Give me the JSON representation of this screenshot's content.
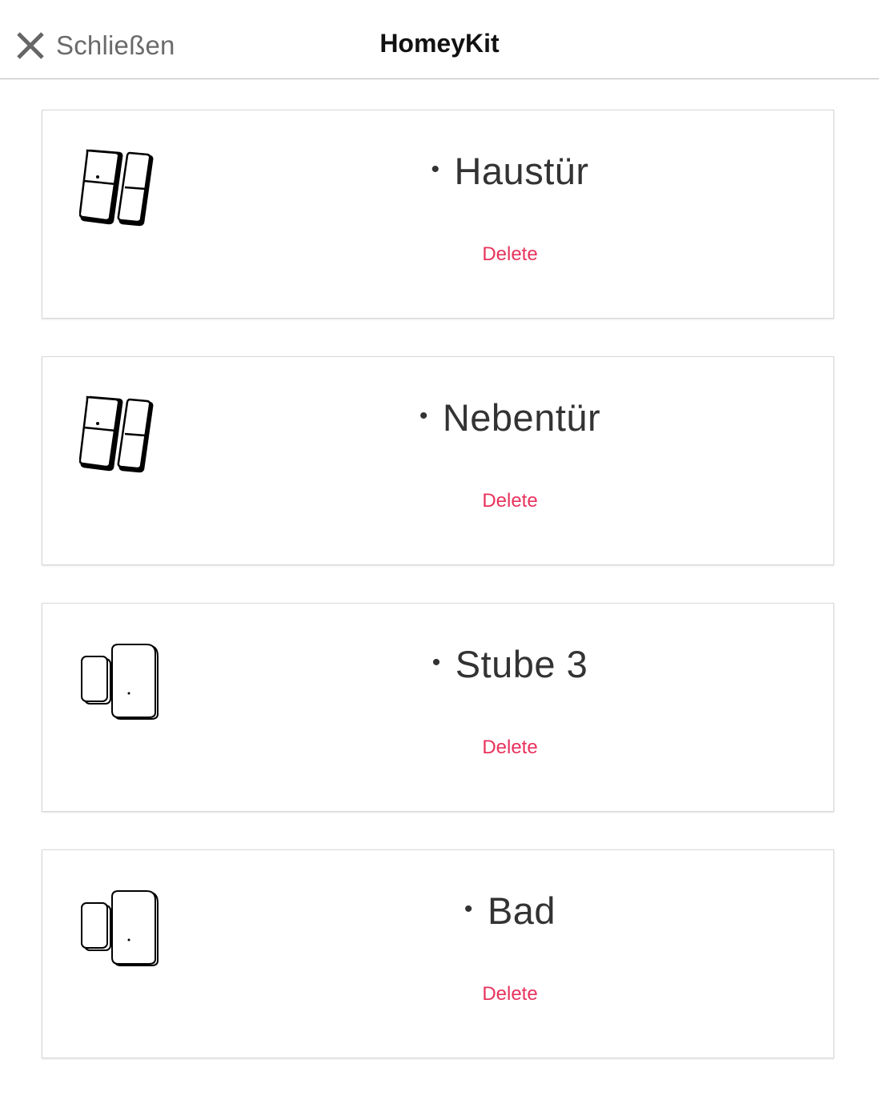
{
  "header": {
    "close_label": "Schließen",
    "title": "HomeyKit",
    "close_icon": "close-icon"
  },
  "devices": [
    {
      "name": "Haustür",
      "delete_label": "Delete",
      "icon": "door-sensor-tall-icon"
    },
    {
      "name": "Nebentür",
      "delete_label": "Delete",
      "icon": "door-sensor-tall-icon"
    },
    {
      "name": "Stube 3",
      "delete_label": "Delete",
      "icon": "door-sensor-compact-icon"
    },
    {
      "name": "Bad",
      "delete_label": "Delete",
      "icon": "door-sensor-compact-icon"
    }
  ],
  "colors": {
    "delete": "#e8325c",
    "text": "#333333",
    "close_text": "#6a6a6a"
  }
}
